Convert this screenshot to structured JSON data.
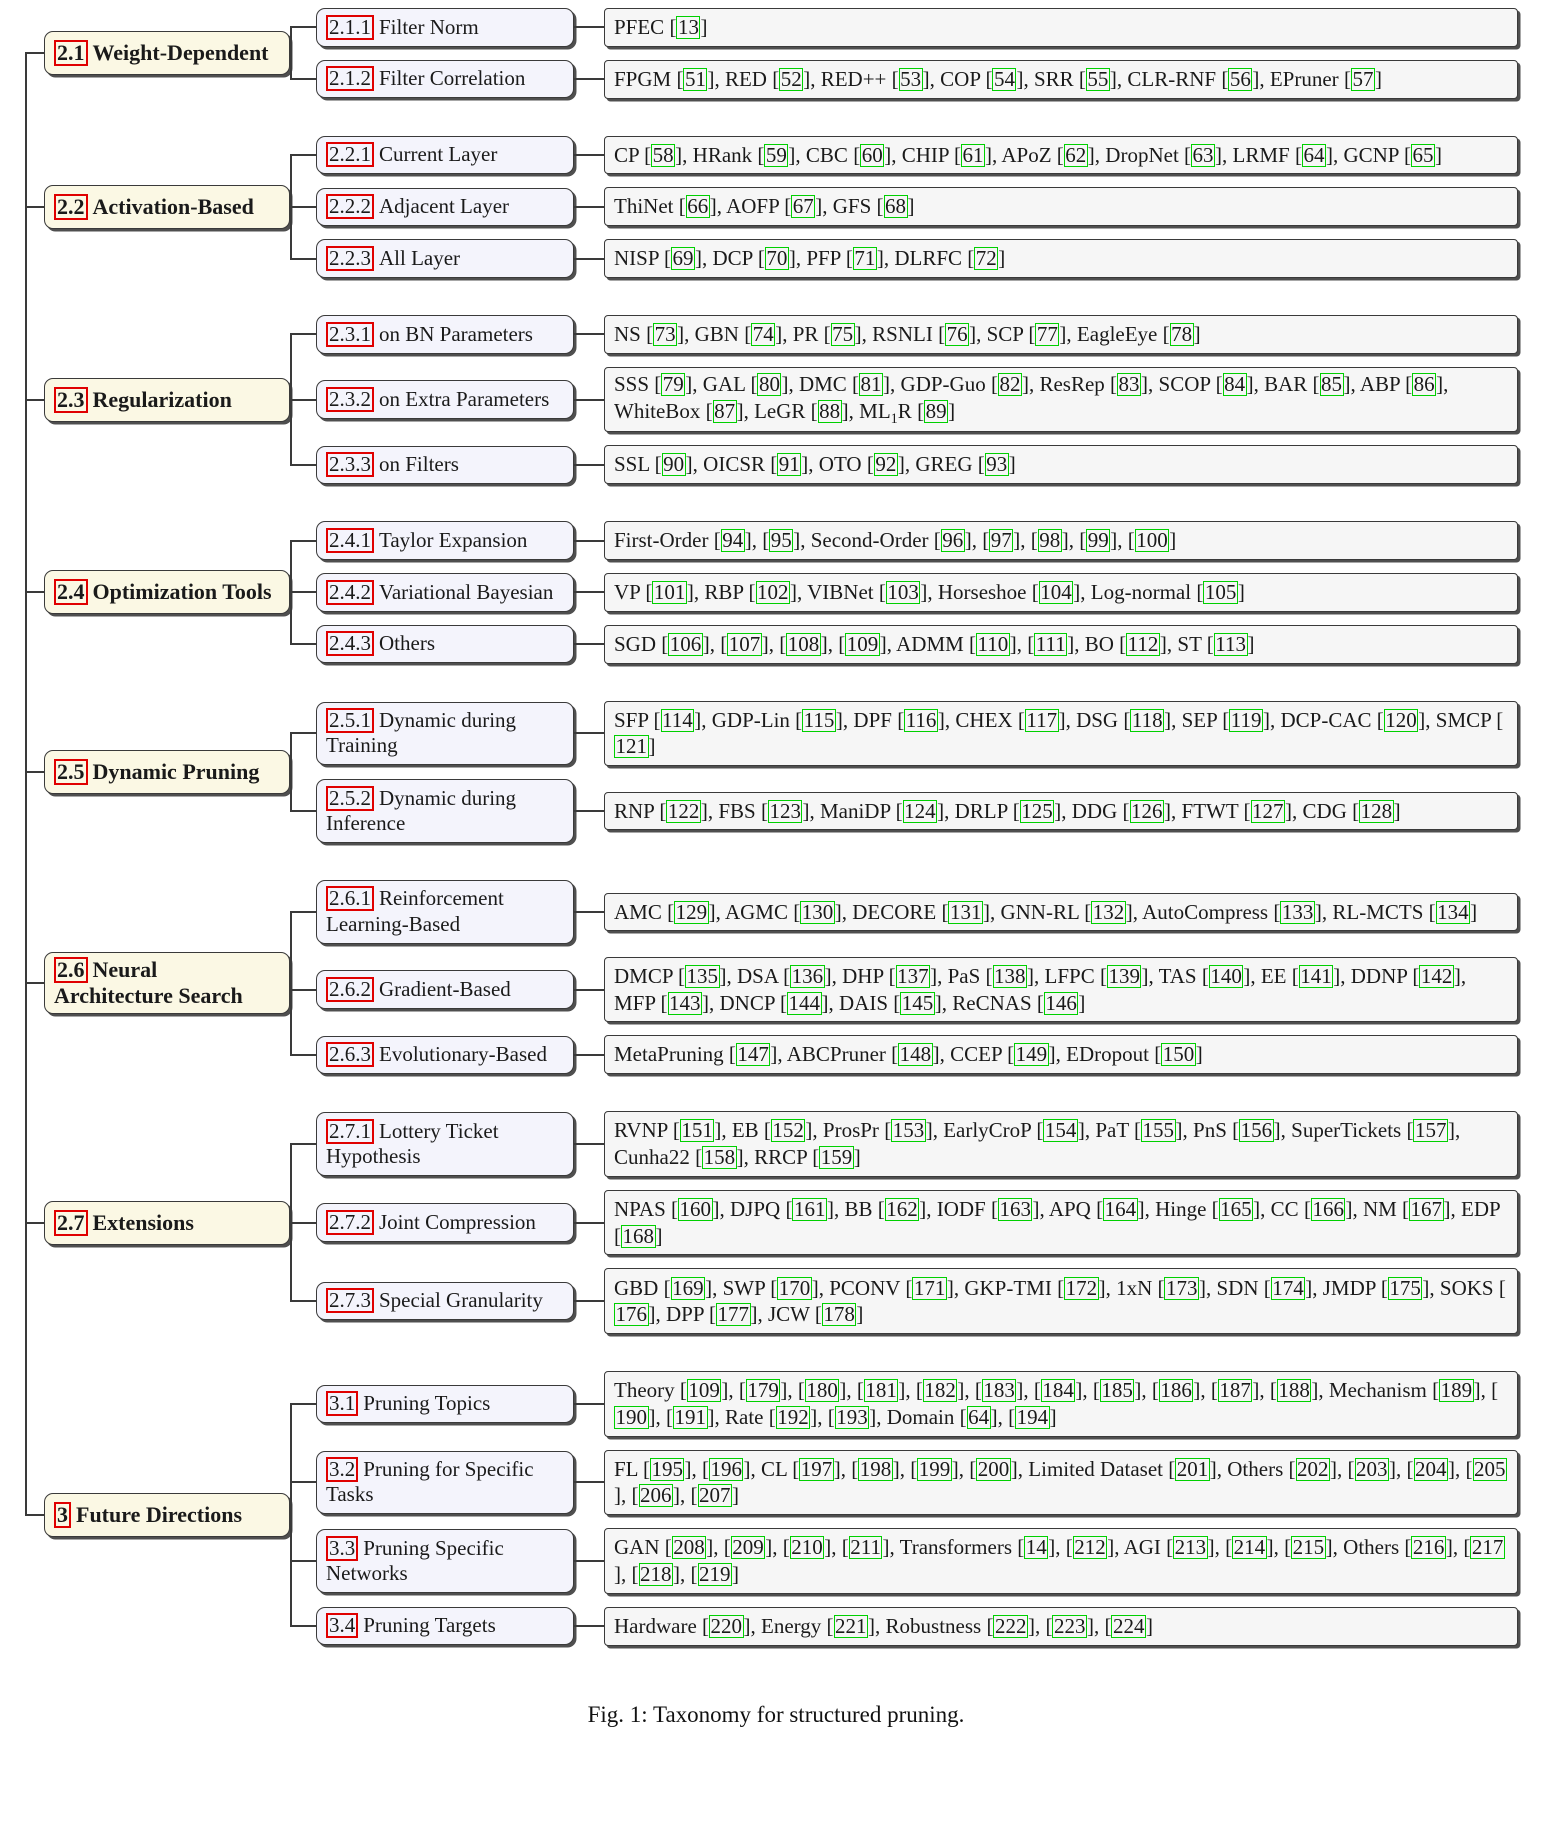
{
  "figure": {
    "caption": "Fig. 1: Taxonomy for structured pruning.",
    "colors": {
      "level1_fill": "#FBF8E4",
      "level2_fill": "#F4F4FC",
      "leaf_fill": "#F6F6F6",
      "section_link_box": "#E00000",
      "citation_link_box": "#00D000",
      "line": "#3a3a3a"
    }
  },
  "branches": [
    {
      "num": "2.1",
      "label": "Weight-Dependent",
      "children": [
        {
          "num": "2.1.1",
          "label": "Filter Norm",
          "leaf": "PFEC [13]"
        },
        {
          "num": "2.1.2",
          "label": "Filter Correlation",
          "leaf": "FPGM [51], RED [52], RED++ [53], COP [54], SRR [55], CLR-RNF [56], EPruner [57]"
        }
      ]
    },
    {
      "num": "2.2",
      "label": "Activation-Based",
      "children": [
        {
          "num": "2.2.1",
          "label": "Current Layer",
          "leaf": "CP [58], HRank [59], CBC [60], CHIP [61], APoZ [62], DropNet [63], LRMF [64], GCNP [65]"
        },
        {
          "num": "2.2.2",
          "label": "Adjacent Layer",
          "leaf": "ThiNet [66], AOFP [67], GFS [68]"
        },
        {
          "num": "2.2.3",
          "label": "All Layer",
          "leaf": "NISP [69], DCP [70], PFP [71], DLRFC [72]"
        }
      ]
    },
    {
      "num": "2.3",
      "label": "Regularization",
      "children": [
        {
          "num": "2.3.1",
          "label": "on BN Parameters",
          "leaf": "NS [73], GBN [74], PR [75], RSNLI [76], SCP [77], EagleEye [78]"
        },
        {
          "num": "2.3.2",
          "label": "on Extra Parameters",
          "leaf": "SSS [79], GAL [80], DMC [81], GDP-Guo [82], ResRep [83], SCOP [84], BAR [85], ABP [86], WhiteBox [87], LeGR [88], ML<sub>1</sub>R [89]"
        },
        {
          "num": "2.3.3",
          "label": "on Filters",
          "leaf": "SSL [90], OICSR [91], OTO [92], GREG [93]"
        }
      ]
    },
    {
      "num": "2.4",
      "label": "Optimization Tools",
      "children": [
        {
          "num": "2.4.1",
          "label": "Taylor Expansion",
          "leaf": "First-Order [94], [95], Second-Order [96], [97], [98], [99], [100]"
        },
        {
          "num": "2.4.2",
          "label": "Variational Bayesian",
          "leaf": "VP [101], RBP [102], VIBNet [103], Horseshoe [104], Log-normal [105]"
        },
        {
          "num": "2.4.3",
          "label": "Others",
          "leaf": "SGD [106], [107], [108], [109], ADMM [110], [111], BO [112], ST [113]"
        }
      ]
    },
    {
      "num": "2.5",
      "label": "Dynamic Pruning",
      "children": [
        {
          "num": "2.5.1",
          "label": "Dynamic during Training",
          "leaf": "SFP [114], GDP-Lin [115], DPF [116], CHEX [117], DSG [118], SEP [119], DCP-CAC [120], SMCP [121]"
        },
        {
          "num": "2.5.2",
          "label": "Dynamic during Inference",
          "leaf": "RNP [122], FBS [123], ManiDP [124], DRLP [125], DDG [126], FTWT [127], CDG [128]"
        }
      ]
    },
    {
      "num": "2.6",
      "label": "Neural Architecture Search",
      "children": [
        {
          "num": "2.6.1",
          "label": "Reinforcement Learning-Based",
          "leaf": "AMC [129], AGMC [130], DECORE [131], GNN-RL [132], AutoCompress [133], RL-MCTS [134]"
        },
        {
          "num": "2.6.2",
          "label": "Gradient-Based",
          "leaf": "DMCP [135], DSA [136], DHP [137], PaS [138], LFPC [139], TAS [140], EE [141], DDNP [142], MFP [143], DNCP [144], DAIS [145], ReCNAS [146]"
        },
        {
          "num": "2.6.3",
          "label": "Evolutionary-Based",
          "leaf": "MetaPruning [147], ABCPruner [148], CCEP [149], EDropout [150]"
        }
      ]
    },
    {
      "num": "2.7",
      "label": "Extensions",
      "children": [
        {
          "num": "2.7.1",
          "label": "Lottery Ticket Hypothesis",
          "leaf": "RVNP [151], EB [152], ProsPr [153], EarlyCroP [154], PaT [155], PnS [156], SuperTickets [157], Cunha22 [158], RRCP [159]"
        },
        {
          "num": "2.7.2",
          "label": "Joint Compression",
          "leaf": "NPAS [160], DJPQ [161], BB [162], IODF [163], APQ [164], Hinge [165], CC [166], NM [167], EDP [168]"
        },
        {
          "num": "2.7.3",
          "label": "Special Granularity",
          "leaf": "GBD [169], SWP [170], PCONV [171], GKP-TMI [172], 1xN [173], SDN [174], JMDP [175], SOKS [176], DPP [177], JCW [178]"
        }
      ]
    },
    {
      "num": "3",
      "label": "Future Directions",
      "children": [
        {
          "num": "3.1",
          "label": "Pruning Topics",
          "leaf": "Theory [109], [179], [180], [181], [182], [183], [184], [185], [186], [187], [188], Mechanism [189], [190], [191], Rate [192], [193], Domain [64], [194]"
        },
        {
          "num": "3.2",
          "label": "Pruning for Specific Tasks",
          "leaf": "FL [195], [196], CL [197], [198], [199], [200], Limited Dataset [201], Others [202], [203], [204], [205], [206], [207]"
        },
        {
          "num": "3.3",
          "label": "Pruning Specific Networks",
          "leaf": "GAN [208], [209], [210], [211], Transformers [14], [212], AGI [213], [214], [215], Others [216], [217], [218], [219]"
        },
        {
          "num": "3.4",
          "label": "Pruning Targets",
          "leaf": "Hardware [220], Energy [221], Robustness [222], [223], [224]"
        }
      ]
    }
  ]
}
